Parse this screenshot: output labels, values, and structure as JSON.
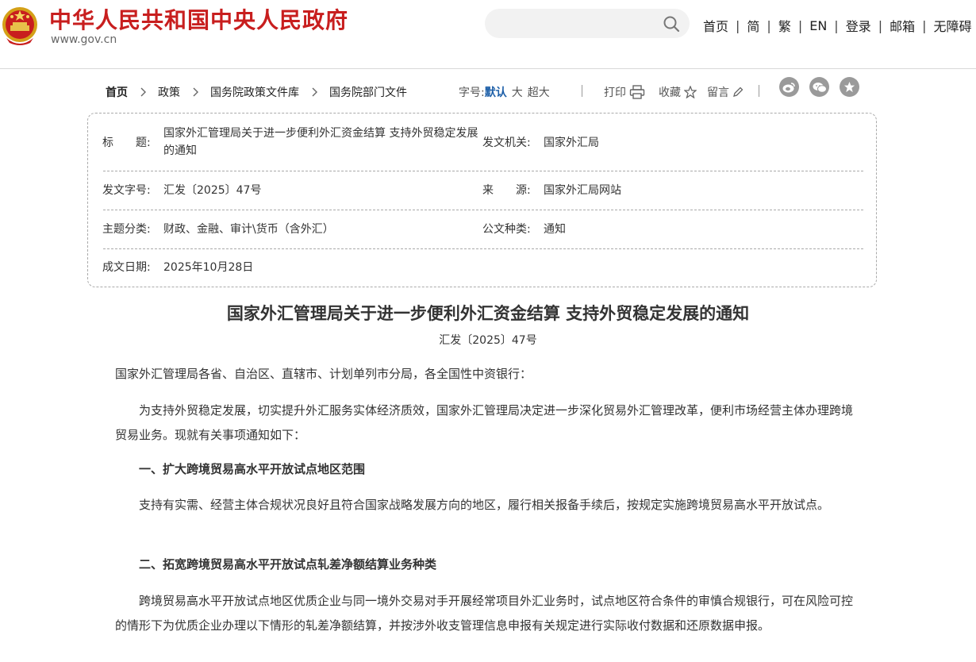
{
  "header": {
    "site_title": "中华人民共和国中央人民政府",
    "site_url": "www.gov.cn",
    "search": {
      "placeholder": ""
    },
    "nav": [
      {
        "label": "首页"
      },
      {
        "label": "简"
      },
      {
        "label": "繁"
      },
      {
        "label": "EN"
      },
      {
        "label": "登录"
      },
      {
        "label": "邮箱"
      },
      {
        "label": "无障碍"
      }
    ],
    "nav_separator": "|"
  },
  "breadcrumb": [
    "首页",
    "政策",
    "国务院政策文件库",
    "国务院部门文件"
  ],
  "tools": {
    "font_label": "字号:",
    "font_options": [
      "默认",
      "大",
      "超大"
    ],
    "print": "打印",
    "favorite": "收藏",
    "comment": "留言"
  },
  "info": {
    "title_label": "标　　题:",
    "title_value": "国家外汇管理局关于进一步便利外汇资金结算 支持外贸稳定发展的通知",
    "issuer_label": "发文机关:",
    "issuer_value": "国家外汇局",
    "docno_label": "发文字号:",
    "docno_value": "汇发〔2025〕47号",
    "source_label": "来　　源:",
    "source_value": "国家外汇局网站",
    "topic_label": "主题分类:",
    "topic_value": "财政、金融、审计\\货币（含外汇）",
    "type_label": "公文种类:",
    "type_value": "通知",
    "date_label": "成文日期:",
    "date_value": "2025年10月28日"
  },
  "article": {
    "title": "国家外汇管理局关于进一步便利外汇资金结算 支持外贸稳定发展的通知",
    "doc_number": "汇发〔2025〕47号",
    "paragraphs": [
      "国家外汇管理局各省、自治区、直辖市、计划单列市分局，各全国性中资银行：",
      "为支持外贸稳定发展，切实提升外汇服务实体经济质效，国家外汇管理局决定进一步深化贸易外汇管理改革，便利市场经营主体办理跨境贸易业务。现就有关事项通知如下：",
      "一、扩大跨境贸易高水平开放试点地区范围",
      "支持有实需、经营主体合规状况良好且符合国家战略发展方向的地区，履行相关报备手续后，按规定实施跨境贸易高水平开放试点。",
      "二、拓宽跨境贸易高水平开放试点轧差净额结算业务种类",
      "跨境贸易高水平开放试点地区优质企业与同一境外交易对手开展经常项目外汇业务时，试点地区符合条件的审慎合规银行，可在风险可控的情形下为优质企业办理以下情形的轧差净额结算，并按涉外收支管理信息申报有关规定进行实际收付数据和还原数据申报。"
    ]
  },
  "colors": {
    "brand_red": "#c81e1e",
    "link_blue": "#1d5fa8",
    "share_grey": "#9a9a9a"
  }
}
